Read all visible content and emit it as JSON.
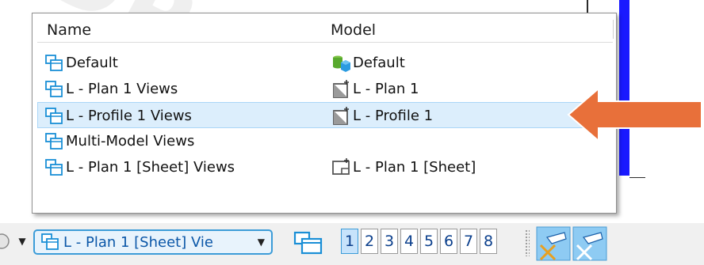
{
  "popup": {
    "columns": {
      "name": "Name",
      "model": "Model"
    },
    "rows": [
      {
        "name": "Default",
        "model": "Default",
        "model_icon": "design-model-icon",
        "selected": false
      },
      {
        "name": "L - Plan 1 Views",
        "model": "L - Plan 1",
        "model_icon": "drawing-model-icon",
        "selected": false
      },
      {
        "name": "L - Profile 1 Views",
        "model": "L - Profile 1",
        "model_icon": "drawing-model-icon",
        "selected": true
      },
      {
        "name": "Multi-Model Views",
        "model": "",
        "model_icon": "",
        "selected": false
      },
      {
        "name": "L - Plan 1 [Sheet] Views",
        "model": "L - Plan 1 [Sheet]",
        "model_icon": "sheet-model-icon",
        "selected": false
      }
    ]
  },
  "toolbar": {
    "combo_value": "L - Plan 1 [Sheet] Vie",
    "view_numbers": [
      "1",
      "2",
      "3",
      "4",
      "5",
      "6",
      "7",
      "8"
    ],
    "active_view": "1"
  },
  "colors": {
    "selection": "#dceefc",
    "arrow": "#e8703a",
    "accent_blue": "#3c9cd8"
  },
  "watermark": "DRAFT"
}
